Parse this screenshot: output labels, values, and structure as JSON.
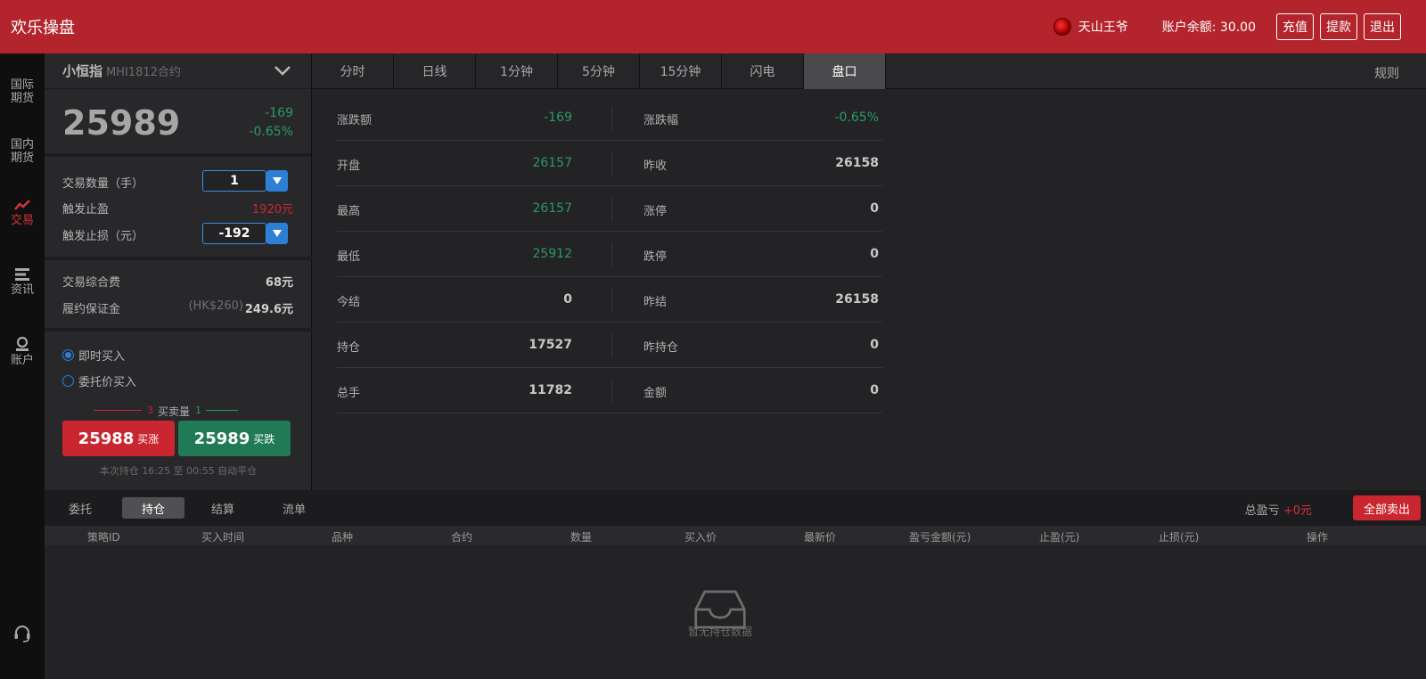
{
  "header": {
    "brand": "欢乐操盘",
    "username": "天山王爷",
    "balance": "账户余额: 30.00",
    "buttons": [
      "充值",
      "提款",
      "退出"
    ]
  },
  "nav": {
    "items": [
      "国际\n期货",
      "国内\n期货",
      "交易",
      "资讯",
      "账户"
    ]
  },
  "contract": {
    "name": "小恒指",
    "code": "MHI1812合约",
    "price": "25989",
    "change": "-169",
    "change_pct": "-0.65%"
  },
  "order_form": {
    "qty_label": "交易数量（手）",
    "qty_value": "1",
    "tp_label": "触发止盈",
    "tp_value": "1920元",
    "sl_label": "触发止损（元）",
    "sl_value": "-192",
    "fee_label": "交易综合费",
    "fee_value": "68元",
    "margin_label": "履约保证金",
    "margin_sub": "(HK$260)",
    "margin_value": "249.6元",
    "radio_market": "即时买入",
    "radio_limit": "委托价买入",
    "book_left": "3",
    "book_label": "买卖量",
    "book_right": "1",
    "buy_up_price": "25988",
    "buy_up_label": "买涨",
    "buy_down_price": "25989",
    "buy_down_label": "买跌",
    "hold_note": "本次持仓 16:25 至 00:55 自动平仓"
  },
  "tabs": [
    "分时",
    "日线",
    "1分钟",
    "5分钟",
    "15分钟",
    "闪电",
    "盘口"
  ],
  "rules": "规则",
  "quote": [
    {
      "l1": "涨跌额",
      "v1": "-169",
      "l2": "涨跌幅",
      "v2": "-0.65%"
    },
    {
      "l1": "开盘",
      "v1": "26157",
      "l2": "昨收",
      "v2": "26158"
    },
    {
      "l1": "最高",
      "v1": "26157",
      "l2": "涨停",
      "v2": "0"
    },
    {
      "l1": "最低",
      "v1": "25912",
      "l2": "跌停",
      "v2": "0"
    },
    {
      "l1": "今结",
      "v1": "0",
      "l2": "昨结",
      "v2": "26158"
    },
    {
      "l1": "持仓",
      "v1": "17527",
      "l2": "昨持仓",
      "v2": "0"
    },
    {
      "l1": "总手",
      "v1": "11782",
      "l2": "金额",
      "v2": "0"
    }
  ],
  "bottom": {
    "tabs": [
      "委托",
      "持仓",
      "结算",
      "流单"
    ],
    "pnl_label": "总盈亏",
    "pnl_value": "+0元",
    "sell_all": "全部卖出",
    "columns": [
      "策略ID",
      "买入时间",
      "品种",
      "合约",
      "数量",
      "买入价",
      "最新价",
      "盈亏金额(元)",
      "止盈(元)",
      "止损(元)",
      "操作"
    ],
    "empty_text": "暂无持仓数据"
  },
  "colors": {
    "brand_red": "#b3242c",
    "up_red": "#c9262f",
    "down_green": "#1f7a55",
    "accent_blue": "#2d7fd6"
  }
}
